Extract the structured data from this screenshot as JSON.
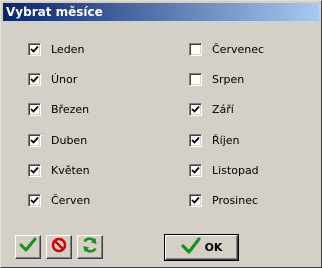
{
  "window": {
    "title": "Vybrat měsíce"
  },
  "months": [
    {
      "label": "Leden",
      "checked": true
    },
    {
      "label": "Únor",
      "checked": true
    },
    {
      "label": "Březen",
      "checked": true
    },
    {
      "label": "Duben",
      "checked": true
    },
    {
      "label": "Květen",
      "checked": true
    },
    {
      "label": "Červen",
      "checked": true
    },
    {
      "label": "Červenec",
      "checked": false
    },
    {
      "label": "Srpen",
      "checked": false
    },
    {
      "label": "Září",
      "checked": true
    },
    {
      "label": "Říjen",
      "checked": true
    },
    {
      "label": "Listopad",
      "checked": true
    },
    {
      "label": "Prosinec",
      "checked": true
    }
  ],
  "toolbar": {
    "select_all_icon": "checkmark-icon",
    "deselect_all_icon": "no-icon",
    "refresh_icon": "refresh-icon"
  },
  "ok_button": {
    "label": "OK",
    "icon": "checkmark-icon"
  },
  "colors": {
    "title_start": "#0a246a",
    "title_end": "#a6caf0",
    "face": "#d4d0c8",
    "check_green": "#1a8f1a",
    "no_red": "#d00000"
  }
}
